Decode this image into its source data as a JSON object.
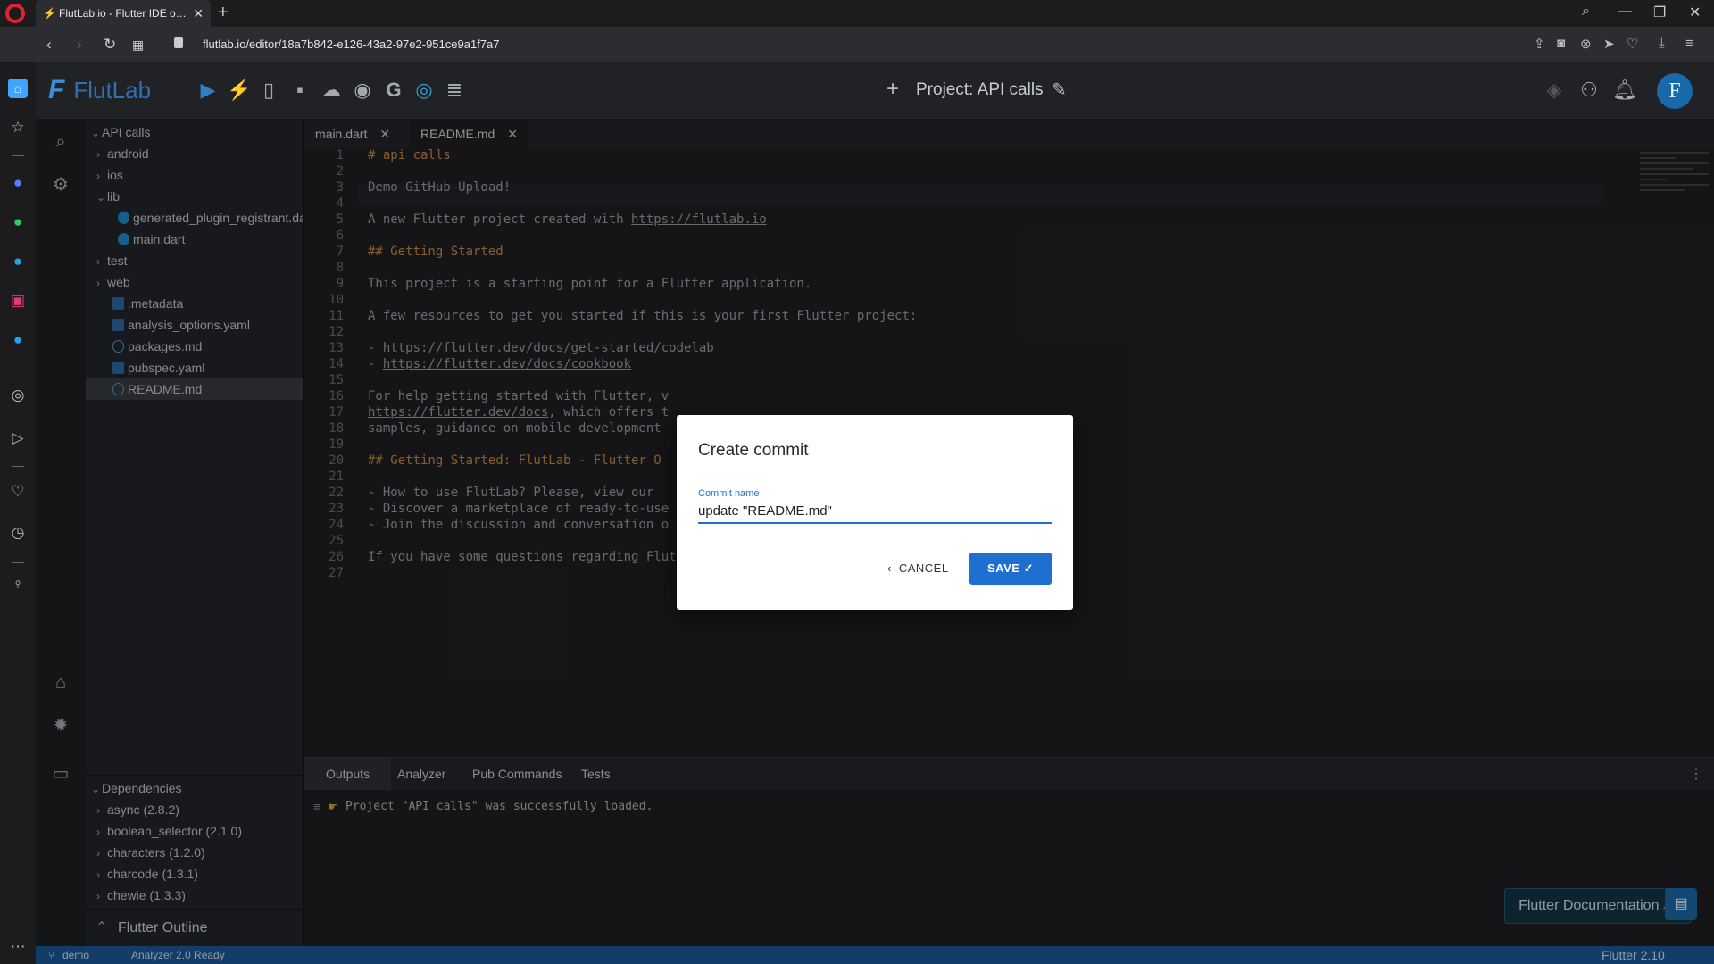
{
  "browser": {
    "tab_title": "FlutLab.io - Flutter IDE online",
    "url": "flutlab.io/editor/18a7b842-e126-43a2-97e2-951ce9a1f7a7"
  },
  "app": {
    "logo_text": "FlutLab",
    "project_title": "Project: API calls",
    "avatar_letter": "F"
  },
  "explorer": {
    "root": "API calls",
    "items": [
      {
        "label": "android",
        "kind": "folder"
      },
      {
        "label": "ios",
        "kind": "folder"
      },
      {
        "label": "lib",
        "kind": "folder-open"
      },
      {
        "label": "generated_plugin_registrant.dart",
        "kind": "dart"
      },
      {
        "label": "main.dart",
        "kind": "dart"
      },
      {
        "label": "test",
        "kind": "folder"
      },
      {
        "label": "web",
        "kind": "folder"
      },
      {
        "label": ".metadata",
        "kind": "file"
      },
      {
        "label": "analysis_options.yaml",
        "kind": "file"
      },
      {
        "label": "packages.md",
        "kind": "info"
      },
      {
        "label": "pubspec.yaml",
        "kind": "file"
      },
      {
        "label": "README.md",
        "kind": "info",
        "selected": true
      }
    ]
  },
  "dependencies": {
    "header": "Dependencies",
    "items": [
      "async (2.8.2)",
      "boolean_selector (2.1.0)",
      "characters (1.2.0)",
      "charcode (1.3.1)",
      "chewie (1.3.3)"
    ]
  },
  "outline_label": "Flutter Outline",
  "editor": {
    "tabs": [
      "main.dart",
      "README.md"
    ],
    "active_tab": "README.md",
    "lines": [
      "# api_calls",
      "",
      "Demo GitHub Upload!",
      "",
      "A new Flutter project created with https://flutlab.io",
      "",
      "## Getting Started",
      "",
      "This project is a starting point for a Flutter application.",
      "",
      "A few resources to get you started if this is your first Flutter project:",
      "",
      "- https://flutter.dev/docs/get-started/codelab",
      "- https://flutter.dev/docs/cookbook",
      "",
      "For help getting started with Flutter, v",
      "https://flutter.dev/docs, which offers t",
      "samples, guidance on mobile development",
      "",
      "## Getting Started: FlutLab - Flutter O",
      "",
      "- How to use FlutLab? Please, view our",
      "- Discover a marketplace of ready-to-use",
      "- Join the discussion and conversation o",
      "",
      "If you have some questions regarding FlutLab, you can ask on https://flutlab.io/faq",
      ""
    ]
  },
  "bottom_panel": {
    "tabs": [
      "Outputs",
      "Analyzer",
      "Pub Commands",
      "Tests"
    ],
    "active_tab": "Outputs",
    "output_message": "Project \"API calls\" was successfully loaded.",
    "docs_button": "Flutter Documentation"
  },
  "status_bar": {
    "branch": "demo",
    "analyzer": "Analyzer 2.0 Ready",
    "flutter_version": "Flutter 2.10"
  },
  "dialog": {
    "title": "Create commit",
    "field_label": "Commit name",
    "field_value": "update \"README.md\"",
    "cancel_label": "CANCEL",
    "save_label": "SAVE"
  },
  "colors": {
    "accent": "#1f6fd0",
    "status_bar": "#1a5a9a",
    "heading_code": "#c98b45"
  }
}
